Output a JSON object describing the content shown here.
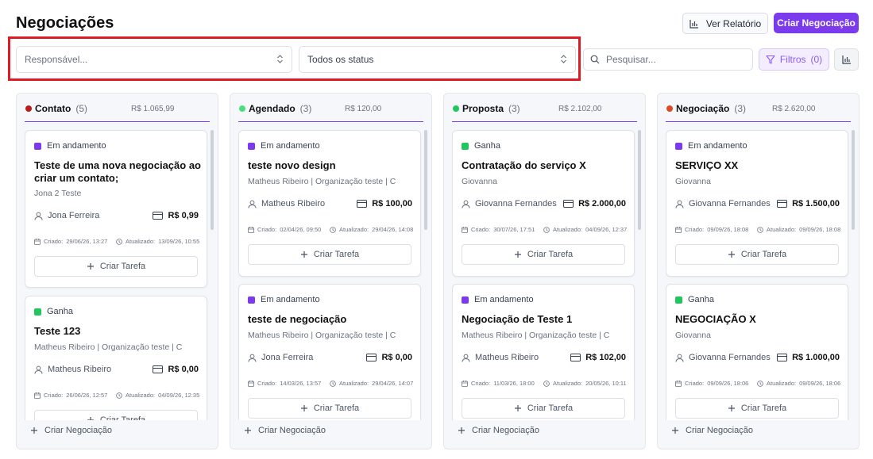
{
  "page": {
    "title": "Negociações",
    "report_label": "Ver Relatório",
    "create_label": "Criar Negociação"
  },
  "filters": {
    "responsible_placeholder": "Responsável...",
    "status_value": "Todos os status",
    "search_placeholder": "Pesquisar...",
    "filter_label": "Filtros",
    "filter_count": "(0)"
  },
  "labels": {
    "created": "Criado:",
    "updated": "Atualizado:",
    "create_task": "Criar Tarefa",
    "create_deal": "Criar Negociação"
  },
  "colors": {
    "accent": "#7c3aed",
    "status_in_progress": "#7c3aed",
    "status_won": "#22c55e"
  },
  "columns": [
    {
      "name": "Contato",
      "count": "(5)",
      "total": "R$ 1.065,99",
      "dot_color": "#b91c1c",
      "cards": [
        {
          "status": "Em andamento",
          "title": "Teste de uma nova negociação ao criar um contato;",
          "subtitle": "Jona 2 Teste",
          "person": "Jona Ferreira",
          "value": "R$ 0,99",
          "created": "29/06/26, 13:27",
          "updated": "13/09/26, 10:55"
        },
        {
          "status": "Ganha",
          "title": "Teste 123",
          "subtitle": "Matheus Ribeiro | Organização teste | C",
          "person": "Matheus Ribeiro",
          "value": "R$ 0,00",
          "created": "26/06/26, 12:57",
          "updated": "04/09/26, 12:35"
        }
      ]
    },
    {
      "name": "Agendado",
      "count": "(3)",
      "total": "R$ 120,00",
      "dot_color": "#4ade80",
      "cards": [
        {
          "status": "Em andamento",
          "title": "teste novo design",
          "subtitle": "Matheus Ribeiro | Organização teste | C",
          "person": "Matheus Ribeiro",
          "value": "R$ 100,00",
          "created": "02/04/26, 09:50",
          "updated": "29/04/26, 14:08"
        },
        {
          "status": "Em andamento",
          "title": "teste de negociação",
          "subtitle": "Matheus Ribeiro | Organização teste | C",
          "person": "Jona Ferreira",
          "value": "R$ 0,00",
          "created": "14/03/26, 13:57",
          "updated": "29/04/26, 14:07"
        }
      ]
    },
    {
      "name": "Proposta",
      "count": "(3)",
      "total": "R$ 2.102,00",
      "dot_color": "#22c55e",
      "cards": [
        {
          "status": "Ganha",
          "title": "Contratação do serviço X",
          "subtitle": "Giovanna",
          "person": "Giovanna Fernandes",
          "value": "R$ 2.000,00",
          "created": "30/07/26, 17:51",
          "updated": "04/09/26, 12:37"
        },
        {
          "status": "Em andamento",
          "title": "Negociação de Teste 1",
          "subtitle": "Matheus Ribeiro | Organização teste | C",
          "person": "Matheus Ribeiro",
          "value": "R$ 102,00",
          "created": "11/03/26, 18:00",
          "updated": "20/05/26, 10:11"
        }
      ]
    },
    {
      "name": "Negociação",
      "count": "(3)",
      "total": "R$ 2.620,00",
      "dot_color": "#dc4a24",
      "cards": [
        {
          "status": "Em andamento",
          "title": "SERVIÇO XX",
          "subtitle": "Giovanna",
          "person": "Giovanna Fernandes",
          "value": "R$ 1.500,00",
          "created": "09/09/26, 18:08",
          "updated": "09/09/26, 18:08"
        },
        {
          "status": "Ganha",
          "title": "NEGOCIAÇÃO X",
          "subtitle": "Giovanna",
          "person": "Giovanna Fernandes",
          "value": "R$ 1.000,00",
          "created": "09/09/26, 18:06",
          "updated": "09/09/26, 18:06"
        }
      ]
    }
  ]
}
